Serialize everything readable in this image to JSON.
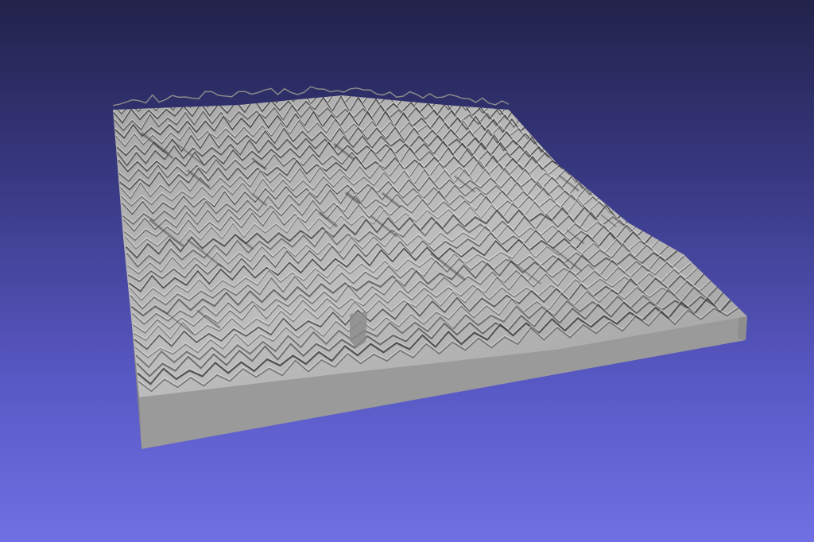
{
  "viewport": {
    "background_top": "#22224a",
    "background_bottom": "#7070e4"
  },
  "model": {
    "kind": "terrain-relief",
    "surface_color": "#b4b4b4",
    "base_front_color": "#9a9a9a",
    "base_side_color": "#8c8c8c",
    "shadow_color": "#3a3a3a"
  }
}
